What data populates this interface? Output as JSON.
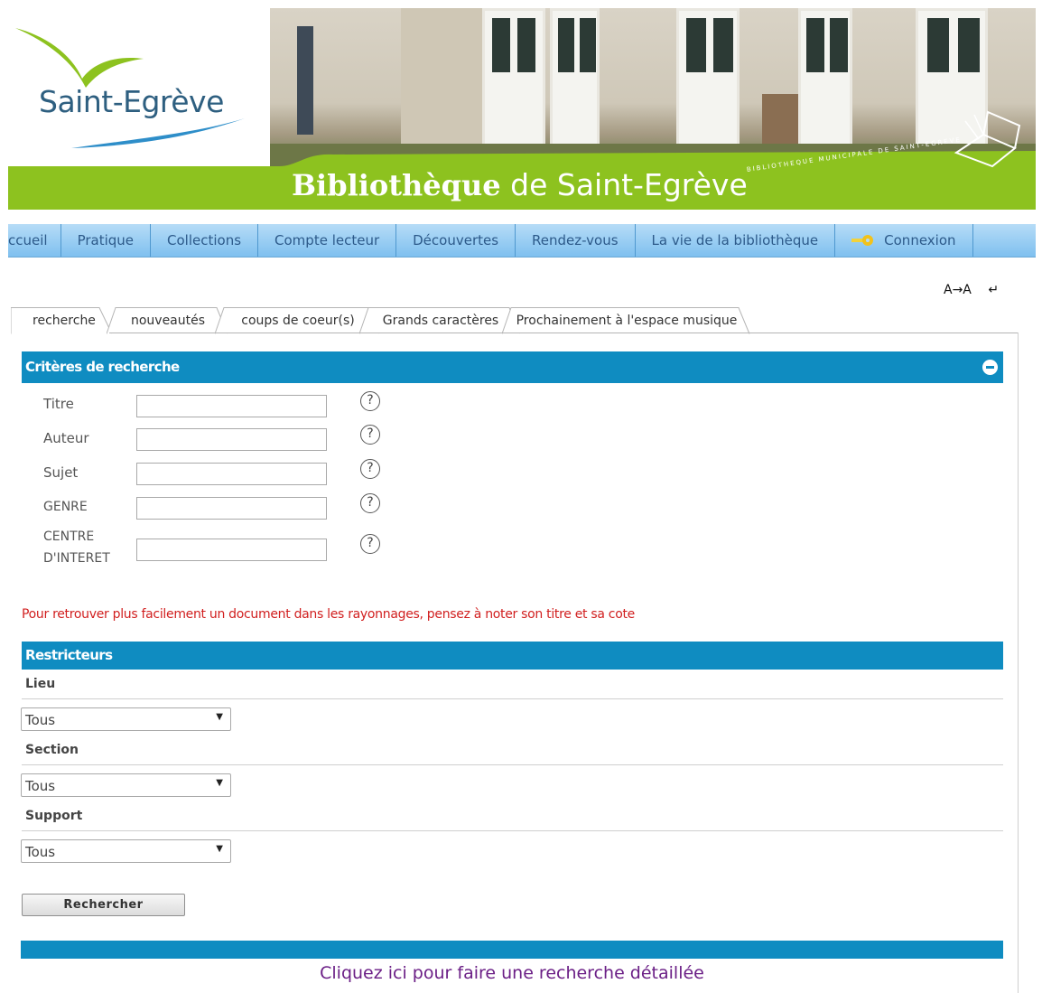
{
  "header": {
    "logo_text": "Saint-Egrève",
    "title_bold": "Bibliothèque",
    "title_rest": " de Saint-Egrève",
    "subtitle": "BIBLIOTHEQUE MUNICIPALE DE SAINT-EGREVE"
  },
  "nav": {
    "items": [
      {
        "label": "Accueil"
      },
      {
        "label": "Pratique"
      },
      {
        "label": "Collections"
      },
      {
        "label": "Compte lecteur"
      },
      {
        "label": "Découvertes"
      },
      {
        "label": "Rendez-vous"
      },
      {
        "label": "La vie de la bibliothèque"
      },
      {
        "label": "Connexion",
        "icon": "key-icon"
      }
    ]
  },
  "tools": {
    "font_size_label": "A→A",
    "back_label": "↵"
  },
  "tabs": [
    {
      "label": "recherche",
      "active": true
    },
    {
      "label": "nouveautés"
    },
    {
      "label": "coups de coeur(s)"
    },
    {
      "label": "Grands caractères"
    },
    {
      "label": "Prochainement à l'espace musique"
    }
  ],
  "criteria": {
    "title": "Critères de recherche",
    "fields": [
      {
        "label": "Titre",
        "value": ""
      },
      {
        "label": "Auteur",
        "value": ""
      },
      {
        "label": "Sujet",
        "value": ""
      },
      {
        "label": "GENRE",
        "value": ""
      },
      {
        "label_line1": "CENTRE",
        "label_line2": "D'INTERET",
        "value": ""
      }
    ],
    "help_glyph": "?"
  },
  "hint": "Pour retrouver plus facilement un document dans les rayonnages, pensez à noter son titre et sa cote",
  "restrictors": {
    "title": "Restricteurs",
    "groups": [
      {
        "label": "Lieu",
        "selected": "Tous"
      },
      {
        "label": "Section",
        "selected": "Tous"
      },
      {
        "label": "Support",
        "selected": "Tous"
      }
    ]
  },
  "search_button": "Rechercher",
  "detail_link": "Cliquez ici pour faire une recherche détaillée",
  "colors": {
    "green": "#8dc21f",
    "section_blue": "#0f8cc1",
    "nav_text": "#2d5a8a",
    "hint_red": "#d11f1f",
    "link_purple": "#6b1f86"
  }
}
